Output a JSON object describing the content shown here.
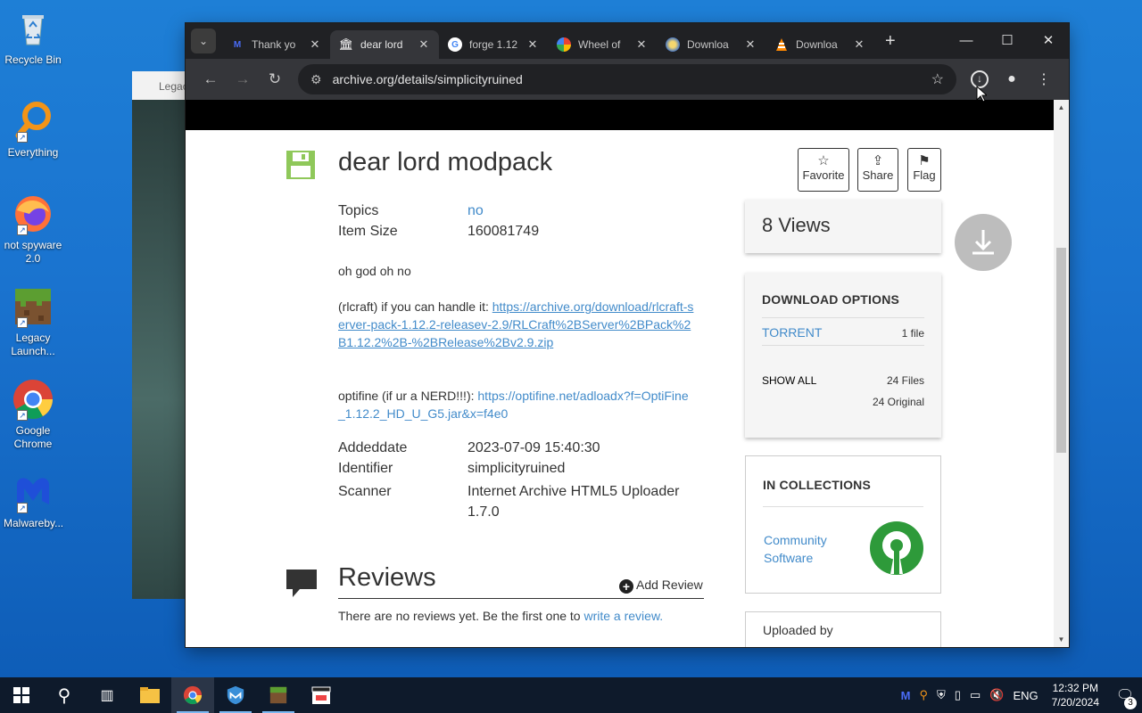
{
  "desktop": {
    "icons": [
      {
        "label": "Recycle Bin"
      },
      {
        "label": "Everything"
      },
      {
        "label": "not spyware 2.0"
      },
      {
        "label": "Legacy Launch..."
      },
      {
        "label": "Google Chrome"
      },
      {
        "label": "Malwareby..."
      }
    ],
    "bg_window_title": "Legac"
  },
  "browser": {
    "tabs": [
      {
        "title": "Thank yo",
        "icon": "malwarebytes-icon"
      },
      {
        "title": "dear lord",
        "icon": "archive-icon",
        "active": true
      },
      {
        "title": "forge 1.12",
        "icon": "google-icon"
      },
      {
        "title": "Wheel of",
        "icon": "wheel-icon"
      },
      {
        "title": "Downloa",
        "icon": "globe-icon"
      },
      {
        "title": "Downloa",
        "icon": "vlc-icon"
      }
    ],
    "url": "archive.org/details/simplicityruined"
  },
  "item": {
    "title": "dear lord modpack",
    "actions": {
      "favorite": "Favorite",
      "share": "Share",
      "flag": "Flag"
    },
    "topics_label": "Topics",
    "topics_value": "no",
    "size_label": "Item Size",
    "size_value": "160081749",
    "desc_line1": "oh god oh no",
    "desc_rl_prefix": "(rlcraft) if you can handle it: ",
    "desc_rl_link": "https://archive.org/download/rlcraft-server-pack-1.12.2-releasev-2.9/RLCraft%2BServer%2BPack%2B1.12.2%2B-%2BRelease%2Bv2.9.zip",
    "desc_of_prefix": "optifine (if ur a NERD!!!): ",
    "desc_of_link": "https://optifine.net/adloadx?f=OptiFine_1.12.2_HD_U_G5.jar&x=f4e0",
    "addeddate_label": "Addeddate",
    "addeddate_value": "2023-07-09 15:40:30",
    "identifier_label": "Identifier",
    "identifier_value": "simplicityruined",
    "scanner_label": "Scanner",
    "scanner_value": "Internet Archive HTML5 Uploader 1.7.0"
  },
  "reviews": {
    "title": "Reviews",
    "add": "Add Review",
    "none_prefix": "There are no reviews yet. Be the first one to ",
    "none_link": "write a review."
  },
  "sidebar": {
    "views": "8 Views",
    "download_header": "DOWNLOAD OPTIONS",
    "torrent": "TORRENT",
    "torrent_count": "1 file",
    "show_all": "SHOW ALL",
    "files_count": "24 Files",
    "original_count": "24 Original",
    "collections_header": "IN COLLECTIONS",
    "collection_name": "Community Software",
    "uploaded_by": "Uploaded by"
  },
  "taskbar": {
    "time": "12:32 PM",
    "date": "7/20/2024",
    "lang": "ENG",
    "notifications": "3"
  },
  "colors": {
    "accent": "#428bca",
    "chrome_dark": "#202124",
    "taskbar": "#0e1a2b"
  }
}
